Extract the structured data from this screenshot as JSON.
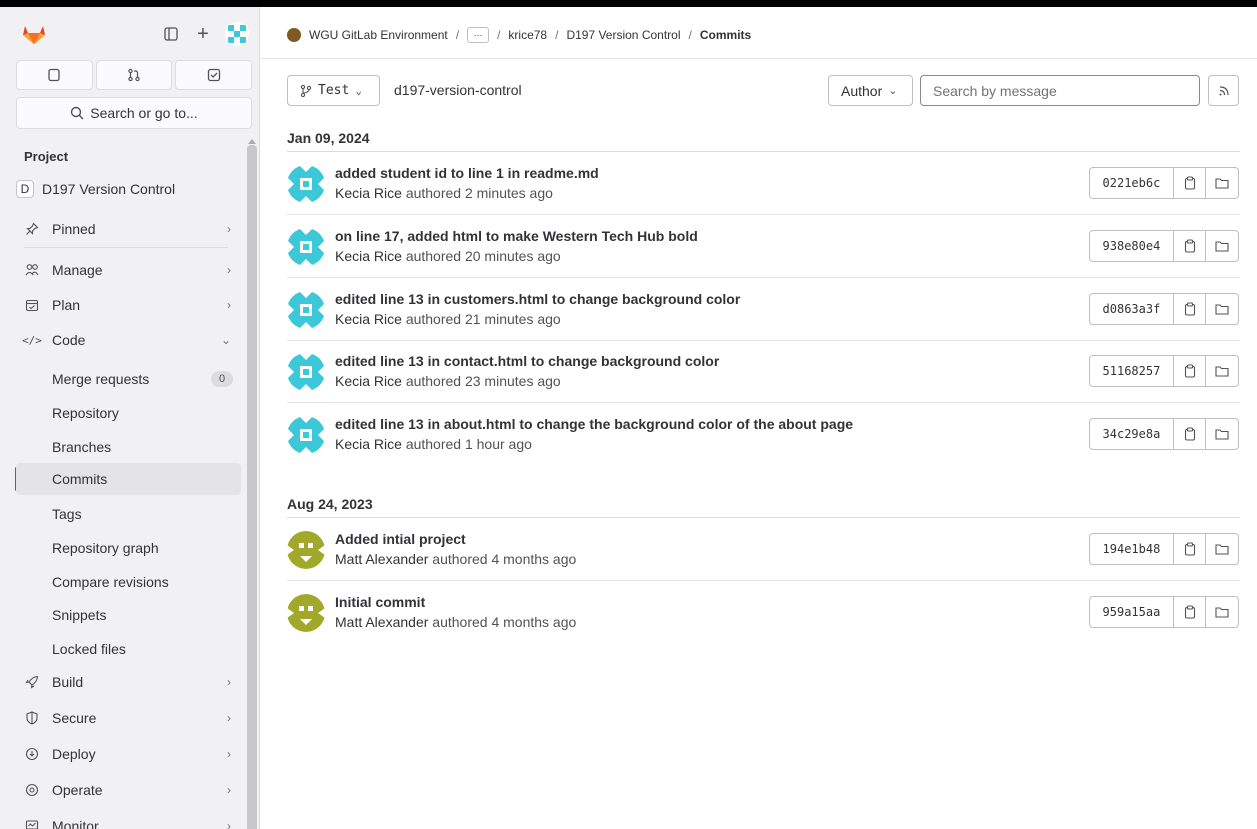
{
  "sidebar": {
    "search_label": "Search or go to...",
    "section_title": "Project",
    "project": {
      "badge": "D",
      "name": "D197 Version Control"
    },
    "items": [
      {
        "label": "Pinned",
        "icon": "pin-icon"
      },
      {
        "label": "Manage",
        "icon": "users-icon"
      },
      {
        "label": "Plan",
        "icon": "calendar-icon"
      },
      {
        "label": "Code",
        "icon": "code-icon"
      },
      {
        "label": "Build",
        "icon": "rocket-icon"
      },
      {
        "label": "Secure",
        "icon": "shield-icon"
      },
      {
        "label": "Deploy",
        "icon": "deploy-icon"
      },
      {
        "label": "Operate",
        "icon": "cloud-icon"
      },
      {
        "label": "Monitor",
        "icon": "monitor-icon"
      }
    ],
    "code_subitems": [
      {
        "label": "Merge requests",
        "count": "0"
      },
      {
        "label": "Repository"
      },
      {
        "label": "Branches"
      },
      {
        "label": "Commits"
      },
      {
        "label": "Tags"
      },
      {
        "label": "Repository graph"
      },
      {
        "label": "Compare revisions"
      },
      {
        "label": "Snippets"
      },
      {
        "label": "Locked files"
      }
    ]
  },
  "breadcrumb": {
    "items": [
      "WGU GitLab Environment",
      "krice78",
      "D197 Version Control"
    ],
    "more": "···",
    "current": "Commits"
  },
  "controls": {
    "branch": "Test",
    "path": "d197-version-control",
    "author_label": "Author",
    "search_placeholder": "Search by message"
  },
  "groups": [
    {
      "date": "Jan 09, 2024",
      "commits": [
        {
          "title": "added student id to line 1 in readme.md",
          "author": "Kecia Rice",
          "time": "authored 2 minutes ago",
          "sha": "0221eb6c"
        },
        {
          "title": "on line 17, added html to make Western Tech Hub bold",
          "author": "Kecia Rice",
          "time": "authored 20 minutes ago",
          "sha": "938e80e4"
        },
        {
          "title": "edited line 13 in customers.html to change background color",
          "author": "Kecia Rice",
          "time": "authored 21 minutes ago",
          "sha": "d0863a3f"
        },
        {
          "title": "edited line 13 in contact.html to change background color",
          "author": "Kecia Rice",
          "time": "authored 23 minutes ago",
          "sha": "51168257"
        },
        {
          "title": "edited line 13 in about.html to change the background color of the about page",
          "author": "Kecia Rice",
          "time": "authored 1 hour ago",
          "sha": "34c29e8a"
        }
      ]
    },
    {
      "date": "Aug 24, 2023",
      "commits": [
        {
          "title": "Added intial project",
          "author": "Matt Alexander",
          "time": "authored 4 months ago",
          "sha": "194e1b48"
        },
        {
          "title": "Initial commit",
          "author": "Matt Alexander",
          "time": "authored 4 months ago",
          "sha": "959a15aa"
        }
      ]
    }
  ],
  "colors": {
    "accent": "#1f75cb",
    "avatar_teal": "#3cc8d8",
    "avatar_olive": "#a2a82a",
    "logo_orange": "#fc6d26"
  }
}
